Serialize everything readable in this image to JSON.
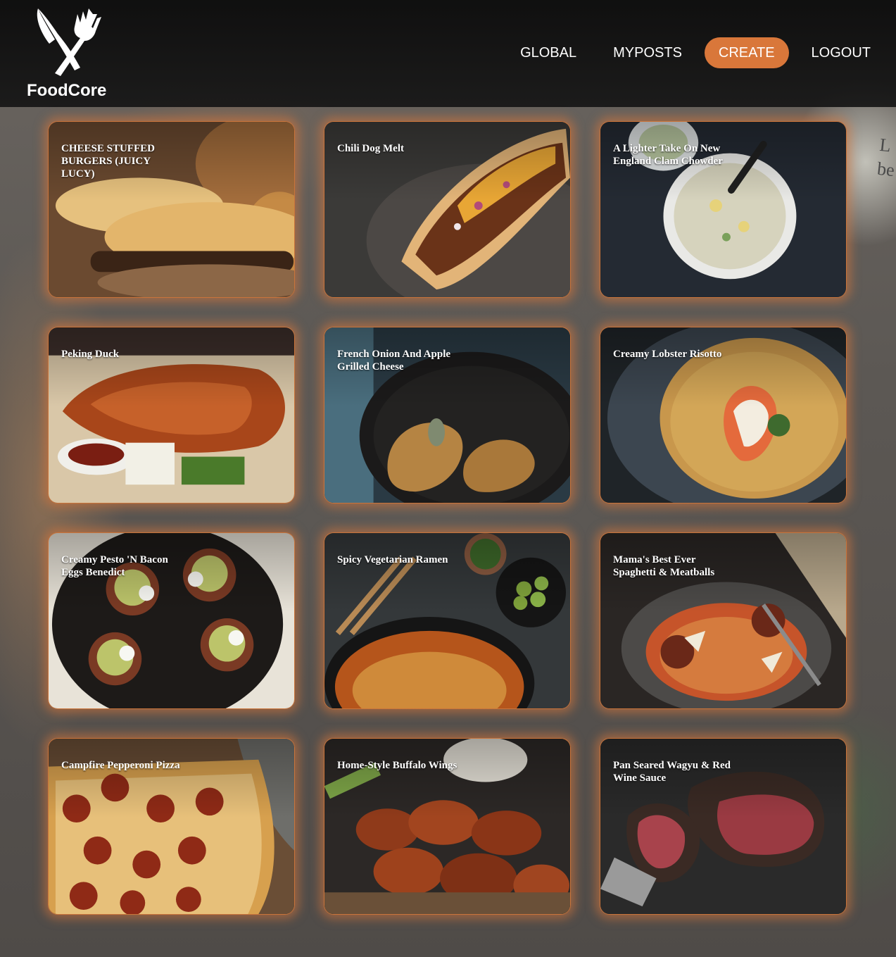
{
  "brand": {
    "name": "FoodCore",
    "logo_icon": "knife-fork-icon"
  },
  "background": {
    "paper_text": "L\nbe"
  },
  "nav": {
    "items": [
      {
        "label": "GLOBAL",
        "active": false
      },
      {
        "label": "MYPOSTS",
        "active": false
      },
      {
        "label": "CREATE",
        "active": true
      },
      {
        "label": "LOGOUT",
        "active": false
      }
    ]
  },
  "colors": {
    "accent": "#d9773a",
    "header_bg": "#111111",
    "card_border": "#c9743b"
  },
  "posts": [
    {
      "title": "CHEESE STUFFED BURGERS (JUICY LUCY)"
    },
    {
      "title": "Chili Dog Melt"
    },
    {
      "title": "A Lighter Take On New England Clam Chowder"
    },
    {
      "title": "Peking Duck"
    },
    {
      "title": "French Onion And Apple Grilled Cheese"
    },
    {
      "title": "Creamy Lobster Risotto"
    },
    {
      "title": "Creamy Pesto 'N Bacon Eggs Benedict"
    },
    {
      "title": "Spicy Vegetarian Ramen"
    },
    {
      "title": "Mama's Best Ever Spaghetti & Meatballs"
    },
    {
      "title": "Campfire Pepperoni Pizza"
    },
    {
      "title": "Home-Style Buffalo Wings"
    },
    {
      "title": "Pan Seared Wagyu & Red Wine Sauce"
    }
  ]
}
